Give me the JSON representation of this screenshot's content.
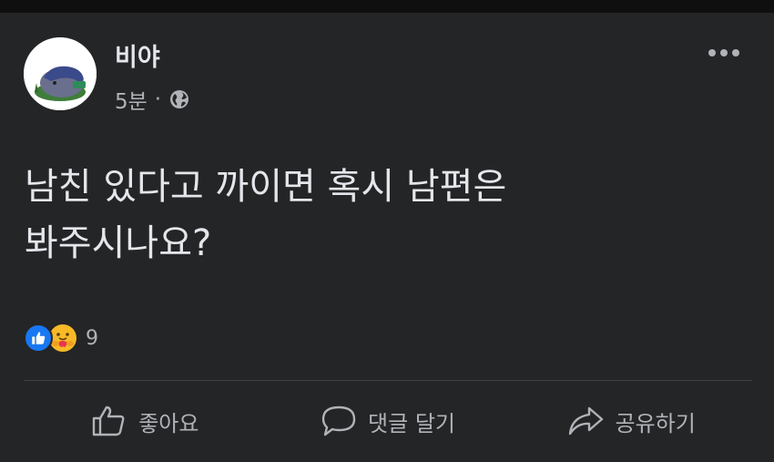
{
  "post": {
    "author": "비야",
    "time": "5분",
    "separator": "·",
    "privacy_icon": "globe-icon",
    "text": "남친 있다고 까이면 혹시 남편은\n봐주시나요?"
  },
  "reactions": {
    "icons": [
      "like-icon",
      "care-icon"
    ],
    "count": "9"
  },
  "actions": {
    "like_label": "좋아요",
    "comment_label": "댓글 달기",
    "share_label": "공유하기"
  },
  "colors": {
    "background": "#242526",
    "text": "#e4e6eb",
    "secondary_text": "#b0b3b8",
    "like_blue": "#1877f2",
    "care_yellow": "#f7b928"
  }
}
